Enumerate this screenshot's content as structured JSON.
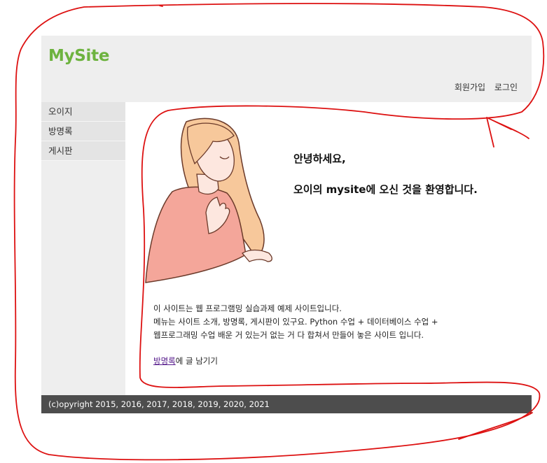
{
  "header": {
    "logo": "MySite",
    "nav": {
      "join": "회원가입",
      "login": "로그인"
    }
  },
  "sidebar": {
    "items": [
      {
        "label": "오이지"
      },
      {
        "label": "방명록"
      },
      {
        "label": "게시판"
      }
    ]
  },
  "main": {
    "welcome_line1": "안녕하세요,",
    "welcome_line2": "오이의 mysite에 오신 것을 환영합니다.",
    "intro_lines": [
      "이 사이트는 웹 프로그램밍 실습과제 예제 사이트입니다.",
      "메뉴는 사이트 소개, 방명록, 게시판이 있구요. Python 수업 + 데이터베이스 수업 +",
      "웹프로그래밍 수업 배운 거 있는거 없는 거 다 합쳐서 만들어 놓은 사이트 입니다."
    ],
    "guestbook_link": "방명록",
    "guestbook_suffix": "에 글 남기기"
  },
  "footer": {
    "text": "(c)opyright 2015, 2016, 2017, 2018, 2019, 2020, 2021"
  },
  "colors": {
    "brand": "#6db33f",
    "footer_bg": "#4d4d4d",
    "panel_bg": "#eeeeee",
    "annotation": "#dd0000"
  }
}
